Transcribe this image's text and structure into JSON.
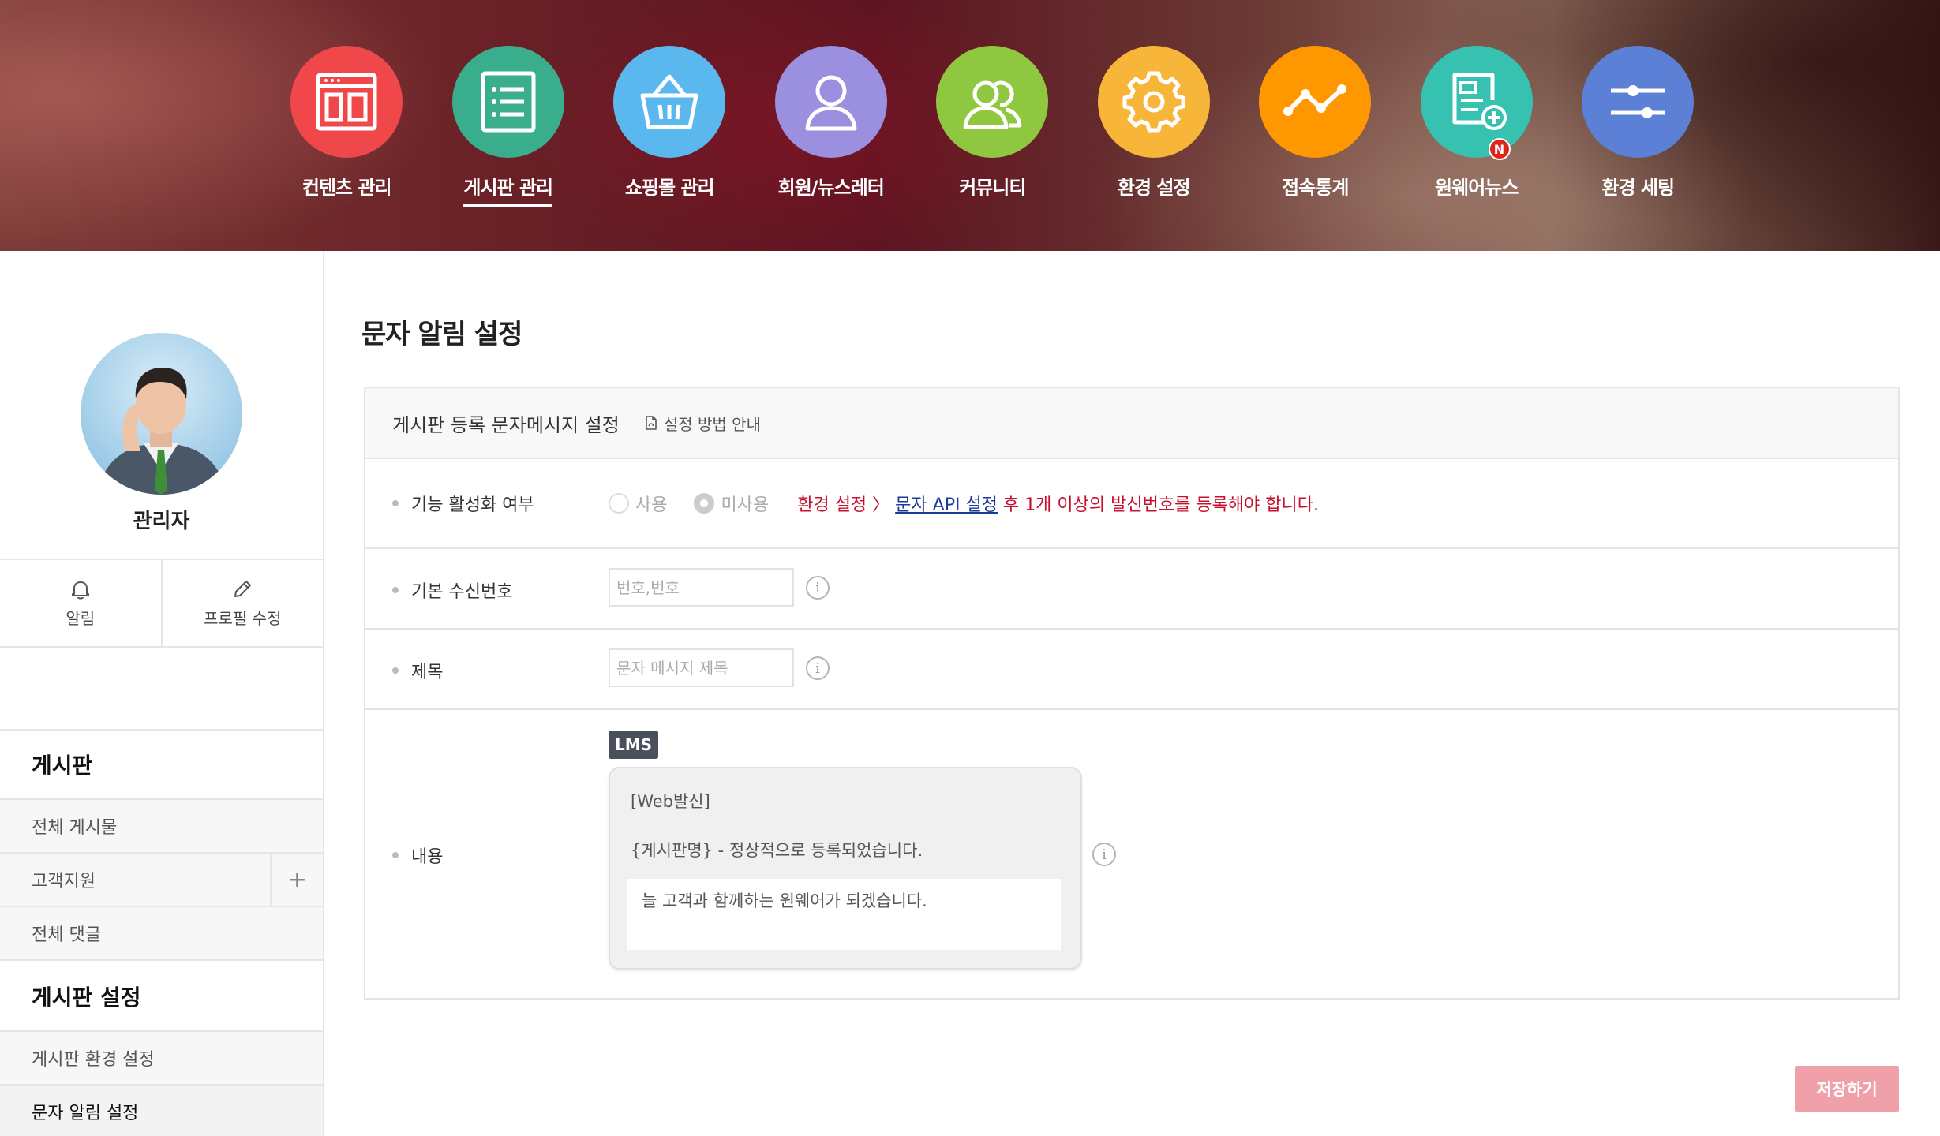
{
  "nav": {
    "items": [
      {
        "label": "컨텐츠 관리",
        "icon": "content-icon",
        "color": "#f0474b"
      },
      {
        "label": "게시판 관리",
        "icon": "board-icon",
        "color": "#3aae8c"
      },
      {
        "label": "쇼핑몰 관리",
        "icon": "basket-icon",
        "color": "#5bb8ef"
      },
      {
        "label": "회원/뉴스레터",
        "icon": "member-icon",
        "color": "#9b8fe0"
      },
      {
        "label": "커뮤니티",
        "icon": "community-icon",
        "color": "#8fc840"
      },
      {
        "label": "환경 설정",
        "icon": "gear-icon",
        "color": "#f7b53a"
      },
      {
        "label": "접속통계",
        "icon": "stats-icon",
        "color": "#ff9800"
      },
      {
        "label": "원웨어뉴스",
        "icon": "news-icon",
        "color": "#36c1b1",
        "badge": "N"
      },
      {
        "label": "환경 세팅",
        "icon": "sliders-icon",
        "color": "#5c80d6"
      }
    ],
    "active_index": 1
  },
  "sidebar": {
    "admin_name": "관리자",
    "quick": {
      "alarm_label": "알림",
      "profile_label": "프로필 수정"
    },
    "sections": [
      {
        "title": "게시판",
        "items": [
          "전체 게시물",
          "고객지원",
          "전체 댓글"
        ]
      },
      {
        "title": "게시판 설정",
        "items": [
          "게시판 환경 설정",
          "문자 알림 설정"
        ]
      }
    ],
    "plus_label": "+"
  },
  "main": {
    "page_title": "문자 알림 설정",
    "panel_title": "게시판 등록 문자메시지 설정",
    "guide_label": "설정 방법 안내",
    "activation": {
      "label": "기능 활성화 여부",
      "option_use": "사용",
      "option_unuse": "미사용",
      "selected": "미사용",
      "notice_prefix": "환경 설정 〉",
      "notice_link": "문자 API 설정",
      "notice_suffix": " 후 1개 이상의 발신번호를 등록해야 합니다."
    },
    "receiver": {
      "label": "기본 수신번호",
      "placeholder": "번호,번호"
    },
    "subject": {
      "label": "제목",
      "placeholder": "문자 메시지 제목"
    },
    "content": {
      "label": "내용",
      "badge": "LMS",
      "line1": "[Web발신]",
      "line2": "{게시판명} - 정상적으로 등록되었습니다.",
      "editable": "늘 고객과 함께하는 원웨어가 되겠습니다."
    },
    "info_glyph": "i",
    "save_label": "저장하기"
  }
}
